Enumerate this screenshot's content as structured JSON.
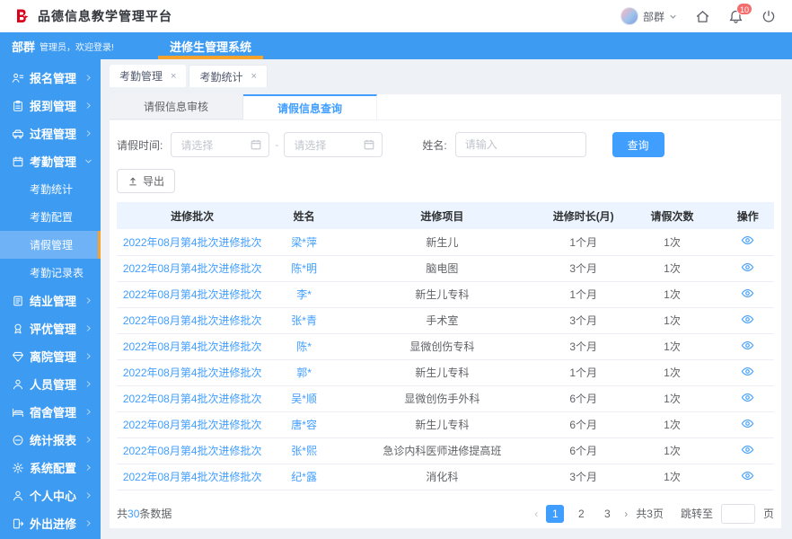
{
  "app": {
    "brand_title": "品德信息教学管理平台",
    "user_name": "部群",
    "notification_count": "10"
  },
  "welcome": {
    "user_name": "部群",
    "message": "管理员，欢迎登录!",
    "system_name": "进修生管理系统"
  },
  "sidebar": {
    "items": [
      {
        "label": "报名管理",
        "icon": "user-list-icon",
        "expanded": false
      },
      {
        "label": "报到管理",
        "icon": "clipboard-icon",
        "expanded": false
      },
      {
        "label": "过程管理",
        "icon": "car-icon",
        "expanded": false
      },
      {
        "label": "考勤管理",
        "icon": "calendar-icon",
        "expanded": true,
        "children": [
          {
            "label": "考勤统计",
            "active": false
          },
          {
            "label": "考勤配置",
            "active": false
          },
          {
            "label": "请假管理",
            "active": true
          },
          {
            "label": "考勤记录表",
            "active": false
          }
        ]
      },
      {
        "label": "结业管理",
        "icon": "file-icon",
        "expanded": false
      },
      {
        "label": "评优管理",
        "icon": "award-icon",
        "expanded": false
      },
      {
        "label": "离院管理",
        "icon": "gem-icon",
        "expanded": false
      },
      {
        "label": "人员管理",
        "icon": "user-icon",
        "expanded": false
      },
      {
        "label": "宿舍管理",
        "icon": "bed-icon",
        "expanded": false
      },
      {
        "label": "统计报表",
        "icon": "chart-icon",
        "expanded": false
      },
      {
        "label": "系统配置",
        "icon": "gear-icon",
        "expanded": false
      },
      {
        "label": "个人中心",
        "icon": "person-icon",
        "expanded": false
      },
      {
        "label": "外出进修",
        "icon": "exit-icon",
        "expanded": false
      }
    ]
  },
  "page_tabs": [
    {
      "label": "考勤管理",
      "active": true
    },
    {
      "label": "考勤统计",
      "active": false
    }
  ],
  "sub_tabs": [
    {
      "label": "请假信息审核",
      "active": false
    },
    {
      "label": "请假信息查询",
      "active": true
    }
  ],
  "filters": {
    "time_label": "请假时间:",
    "date_start_placeholder": "请选择",
    "date_separator": "-",
    "date_end_placeholder": "请选择",
    "name_label": "姓名:",
    "name_placeholder": "请输入",
    "name_value": "",
    "search_label": "查询",
    "export_label": "导出"
  },
  "table": {
    "columns": [
      "进修批次",
      "姓名",
      "进修项目",
      "进修时长(月)",
      "请假次数",
      "操作"
    ],
    "rows": [
      {
        "batch": "2022年08月第4批次进修批次",
        "name": "梁*萍",
        "project": "新生儿",
        "duration": "1个月",
        "leave_count": "1次"
      },
      {
        "batch": "2022年08月第4批次进修批次",
        "name": "陈*明",
        "project": "脑电图",
        "duration": "3个月",
        "leave_count": "1次"
      },
      {
        "batch": "2022年08月第4批次进修批次",
        "name": "李*",
        "project": "新生儿专科",
        "duration": "1个月",
        "leave_count": "1次"
      },
      {
        "batch": "2022年08月第4批次进修批次",
        "name": "张*青",
        "project": "手术室",
        "duration": "3个月",
        "leave_count": "1次"
      },
      {
        "batch": "2022年08月第4批次进修批次",
        "name": "陈*",
        "project": "显微创伤专科",
        "duration": "3个月",
        "leave_count": "1次"
      },
      {
        "batch": "2022年08月第4批次进修批次",
        "name": "郭*",
        "project": "新生儿专科",
        "duration": "1个月",
        "leave_count": "1次"
      },
      {
        "batch": "2022年08月第4批次进修批次",
        "name": "吴*顺",
        "project": "显微创伤手外科",
        "duration": "6个月",
        "leave_count": "1次"
      },
      {
        "batch": "2022年08月第4批次进修批次",
        "name": "唐*容",
        "project": "新生儿专科",
        "duration": "6个月",
        "leave_count": "1次"
      },
      {
        "batch": "2022年08月第4批次进修批次",
        "name": "张*熙",
        "project": "急诊内科医师进修提高班",
        "duration": "6个月",
        "leave_count": "1次"
      },
      {
        "batch": "2022年08月第4批次进修批次",
        "name": "纪*露",
        "project": "消化科",
        "duration": "3个月",
        "leave_count": "1次"
      }
    ]
  },
  "pagination": {
    "total_prefix": "共",
    "total_count": "30",
    "total_suffix": "条数据",
    "prev_arrow": "‹",
    "next_arrow": "›",
    "pages": [
      "1",
      "2",
      "3"
    ],
    "active_page": "1",
    "pages_total": "共3页",
    "jump_label": "跳转至",
    "jump_unit": "页",
    "jump_value": ""
  },
  "colors": {
    "primary_blue": "#3d9bf2",
    "accent_blue": "#409eff",
    "accent_orange": "#f7a22d",
    "badge_red": "#f56c6c",
    "logo_red": "#d9001b",
    "table_header_bg": "#ecf5ff"
  }
}
